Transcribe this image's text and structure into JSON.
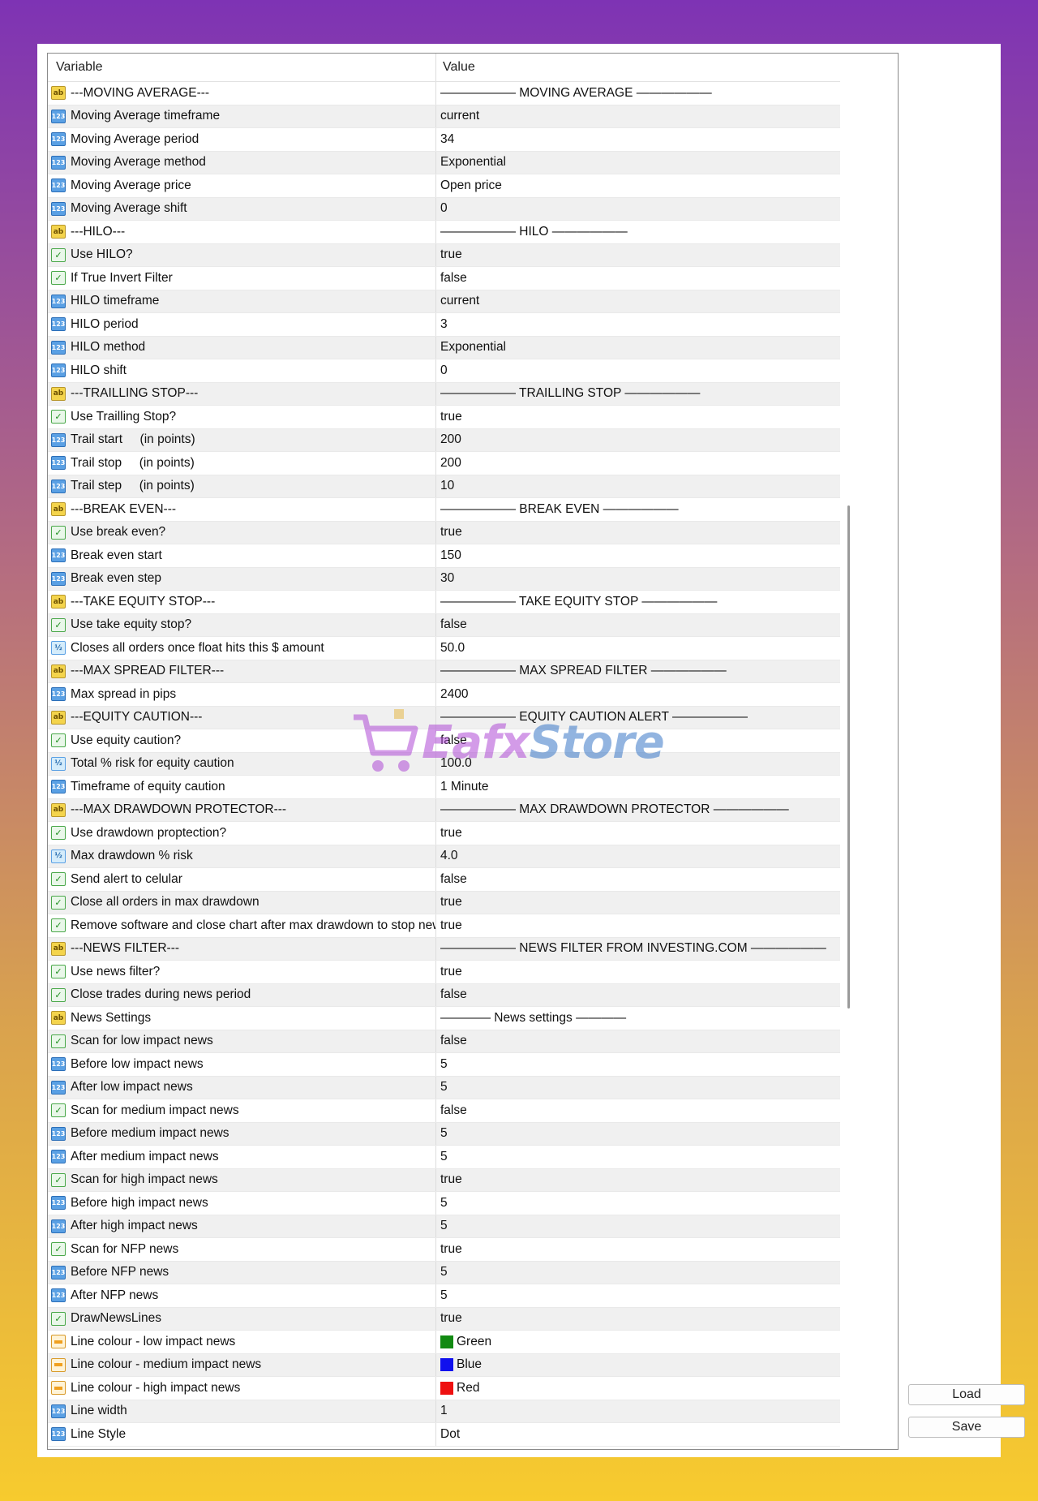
{
  "headers": {
    "variable": "Variable",
    "value": "Value"
  },
  "buttons": {
    "load": "Load",
    "save": "Save"
  },
  "watermark": {
    "text_a": "Eafx",
    "text_b": "Store"
  },
  "rows": [
    {
      "icon": "ab",
      "variable": "---MOVING AVERAGE---",
      "value": "—————— MOVING AVERAGE ——————"
    },
    {
      "icon": "num",
      "variable": "Moving Average timeframe",
      "value": "current"
    },
    {
      "icon": "num",
      "variable": "Moving Average period",
      "value": "34"
    },
    {
      "icon": "num",
      "variable": "Moving Average method",
      "value": "Exponential"
    },
    {
      "icon": "num",
      "variable": "Moving Average price",
      "value": "Open price"
    },
    {
      "icon": "num",
      "variable": "Moving Average shift",
      "value": "0"
    },
    {
      "icon": "ab",
      "variable": "---HILO---",
      "value": "—————— HILO ——————"
    },
    {
      "icon": "bool",
      "variable": "Use HILO?",
      "value": "true"
    },
    {
      "icon": "bool",
      "variable": "If True Invert Filter",
      "value": "false"
    },
    {
      "icon": "num",
      "variable": "HILO timeframe",
      "value": "current"
    },
    {
      "icon": "num",
      "variable": "HILO period",
      "value": "3"
    },
    {
      "icon": "num",
      "variable": "HILO method",
      "value": "Exponential"
    },
    {
      "icon": "num",
      "variable": "HILO shift",
      "value": "0"
    },
    {
      "icon": "ab",
      "variable": "---TRAILLING STOP---",
      "value": "—————— TRAILLING STOP ——————"
    },
    {
      "icon": "bool",
      "variable": "Use Trailling Stop?",
      "value": "true"
    },
    {
      "icon": "num",
      "variable": "Trail start     (in points)",
      "value": "200"
    },
    {
      "icon": "num",
      "variable": "Trail stop     (in points)",
      "value": "200"
    },
    {
      "icon": "num",
      "variable": "Trail step     (in points)",
      "value": "10"
    },
    {
      "icon": "ab",
      "variable": "---BREAK EVEN---",
      "value": "—————— BREAK EVEN ——————"
    },
    {
      "icon": "bool",
      "variable": "Use break even?",
      "value": "true"
    },
    {
      "icon": "num",
      "variable": "Break even start",
      "value": "150"
    },
    {
      "icon": "num",
      "variable": "Break even step",
      "value": "30"
    },
    {
      "icon": "ab",
      "variable": "---TAKE EQUITY STOP---",
      "value": "—————— TAKE EQUITY STOP ——————"
    },
    {
      "icon": "bool",
      "variable": "Use take equity stop?",
      "value": "false"
    },
    {
      "icon": "dbl",
      "variable": "Closes all orders once float hits this $ amount",
      "value": "50.0"
    },
    {
      "icon": "ab",
      "variable": "---MAX SPREAD FILTER---",
      "value": "—————— MAX SPREAD FILTER ——————"
    },
    {
      "icon": "num",
      "variable": "Max spread in pips",
      "value": "2400"
    },
    {
      "icon": "ab",
      "variable": "---EQUITY CAUTION---",
      "value": "—————— EQUITY CAUTION ALERT ——————"
    },
    {
      "icon": "bool",
      "variable": "Use equity caution?",
      "value": "false"
    },
    {
      "icon": "dbl",
      "variable": "Total % risk for equity caution",
      "value": "100.0"
    },
    {
      "icon": "num",
      "variable": "Timeframe of equity caution",
      "value": "1 Minute"
    },
    {
      "icon": "ab",
      "variable": "---MAX DRAWDOWN PROTECTOR---",
      "value": "—————— MAX DRAWDOWN PROTECTOR ——————"
    },
    {
      "icon": "bool",
      "variable": "Use drawdown proptection?",
      "value": "true"
    },
    {
      "icon": "dbl",
      "variable": "Max drawdown % risk",
      "value": "4.0"
    },
    {
      "icon": "bool",
      "variable": "Send alert to celular",
      "value": "false"
    },
    {
      "icon": "bool",
      "variable": "Close all orders in max drawdown",
      "value": "true"
    },
    {
      "icon": "bool",
      "variable": "Remove software and close chart after max drawdown to stop new",
      "value": "true"
    },
    {
      "icon": "ab",
      "variable": "---NEWS FILTER---",
      "value": "—————— NEWS FILTER FROM INVESTING.COM ——————"
    },
    {
      "icon": "bool",
      "variable": "Use news filter?",
      "value": "true"
    },
    {
      "icon": "bool",
      "variable": "Close trades during news period",
      "value": "false"
    },
    {
      "icon": "ab",
      "variable": "News Settings",
      "value": "———— News settings ————"
    },
    {
      "icon": "bool",
      "variable": "Scan for low impact news",
      "value": "false"
    },
    {
      "icon": "num",
      "variable": "Before low impact news",
      "value": "5"
    },
    {
      "icon": "num",
      "variable": "After low impact news",
      "value": "5"
    },
    {
      "icon": "bool",
      "variable": "Scan for medium impact news",
      "value": "false"
    },
    {
      "icon": "num",
      "variable": "Before medium impact news",
      "value": "5"
    },
    {
      "icon": "num",
      "variable": "After medium impact news",
      "value": "5"
    },
    {
      "icon": "bool",
      "variable": "Scan for high impact news",
      "value": "true"
    },
    {
      "icon": "num",
      "variable": "Before high impact news",
      "value": "5"
    },
    {
      "icon": "num",
      "variable": "After high impact news",
      "value": "5"
    },
    {
      "icon": "bool",
      "variable": "Scan for NFP news",
      "value": "true"
    },
    {
      "icon": "num",
      "variable": "Before NFP news",
      "value": "5"
    },
    {
      "icon": "num",
      "variable": "After NFP news",
      "value": "5"
    },
    {
      "icon": "bool",
      "variable": "DrawNewsLines",
      "value": "true"
    },
    {
      "icon": "col",
      "variable": "Line colour - low impact news",
      "value": "Green",
      "swatch": "#128a12"
    },
    {
      "icon": "col",
      "variable": "Line colour - medium impact news",
      "value": "Blue",
      "swatch": "#1010ee"
    },
    {
      "icon": "col",
      "variable": "Line colour - high impact news",
      "value": "Red",
      "swatch": "#ee1010"
    },
    {
      "icon": "num",
      "variable": "Line width",
      "value": "1"
    },
    {
      "icon": "num",
      "variable": "Line Style",
      "value": "Dot"
    }
  ]
}
